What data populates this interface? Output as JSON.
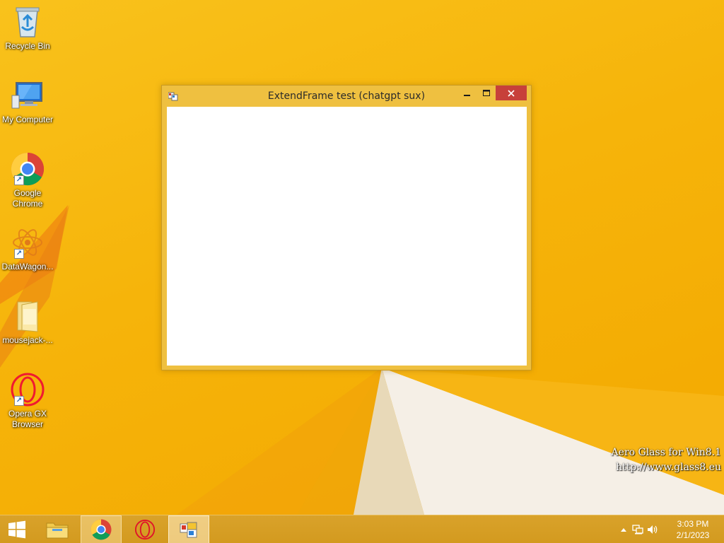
{
  "desktop": {
    "icons": [
      {
        "label": "Recycle Bin",
        "icon": "recycle-bin-icon"
      },
      {
        "label": "My Computer",
        "icon": "computer-icon"
      },
      {
        "label": "Google Chrome",
        "icon": "chrome-icon"
      },
      {
        "label": "DataWagon...",
        "icon": "datawagon-icon"
      },
      {
        "label": "mousejack-...",
        "icon": "folder-icon"
      },
      {
        "label": "Opera GX Browser",
        "icon": "opera-gx-icon"
      }
    ],
    "watermark": {
      "line1": "Aero Glass for Win8.1",
      "line2": "http://www.glass8.eu"
    }
  },
  "window": {
    "title": "ExtendFrame test (chatgpt sux)",
    "minimize_label": "–",
    "maximize_label": "☐",
    "close_label": "✕",
    "accent_color": "#efc040",
    "close_color": "#c7403a"
  },
  "taskbar": {
    "buttons": [
      "start-icon",
      "file-explorer-icon",
      "chrome-icon",
      "opera-gx-icon",
      "app-icon"
    ],
    "tray": {
      "time": "3:03 PM",
      "date": "2/1/2023"
    }
  },
  "colors": {
    "wallpaper": "#f6b40a",
    "taskbar": "#d9a22a"
  }
}
